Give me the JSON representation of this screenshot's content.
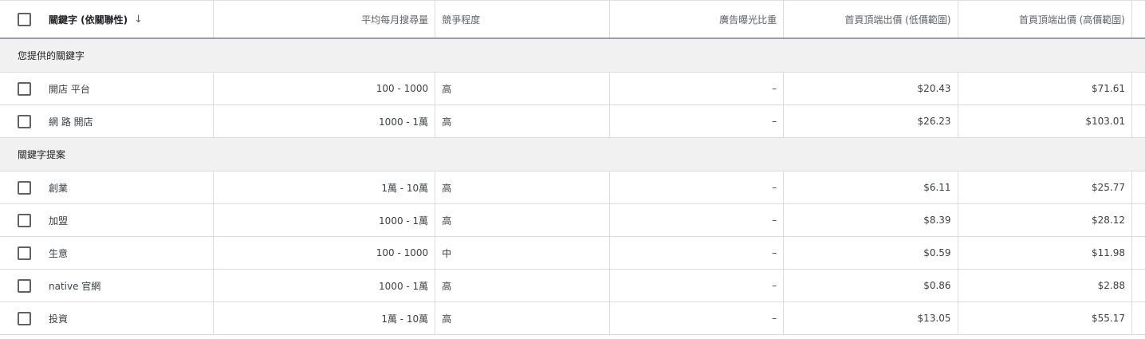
{
  "header": {
    "keyword": "關鍵字 (依關聯性)",
    "avg_monthly": "平均每月搜尋量",
    "competition": "競爭程度",
    "impr_share": "廣告曝光比重",
    "bid_low": "首頁頂端出價 (低價範圍)",
    "bid_high": "首頁頂端出價 (高價範圍)"
  },
  "groups": [
    {
      "title": "您提供的關鍵字",
      "rows": [
        {
          "keyword": "開店 平台",
          "volume": "100 - 1000",
          "competition": "高",
          "share": "–",
          "low": "$20.43",
          "high": "$71.61"
        },
        {
          "keyword": "網 路 開店",
          "volume": "1000 - 1萬",
          "competition": "高",
          "share": "–",
          "low": "$26.23",
          "high": "$103.01"
        }
      ]
    },
    {
      "title": "關鍵字提案",
      "rows": [
        {
          "keyword": "創業",
          "volume": "1萬 - 10萬",
          "competition": "高",
          "share": "–",
          "low": "$6.11",
          "high": "$25.77"
        },
        {
          "keyword": "加盟",
          "volume": "1000 - 1萬",
          "competition": "高",
          "share": "–",
          "low": "$8.39",
          "high": "$28.12"
        },
        {
          "keyword": "生意",
          "volume": "100 - 1000",
          "competition": "中",
          "share": "–",
          "low": "$0.59",
          "high": "$11.98"
        },
        {
          "keyword": "native 官網",
          "volume": "1000 - 1萬",
          "competition": "高",
          "share": "–",
          "low": "$0.86",
          "high": "$2.88"
        },
        {
          "keyword": "投資",
          "volume": "1萬 - 10萬",
          "competition": "高",
          "share": "–",
          "low": "$13.05",
          "high": "$55.17"
        }
      ]
    }
  ]
}
